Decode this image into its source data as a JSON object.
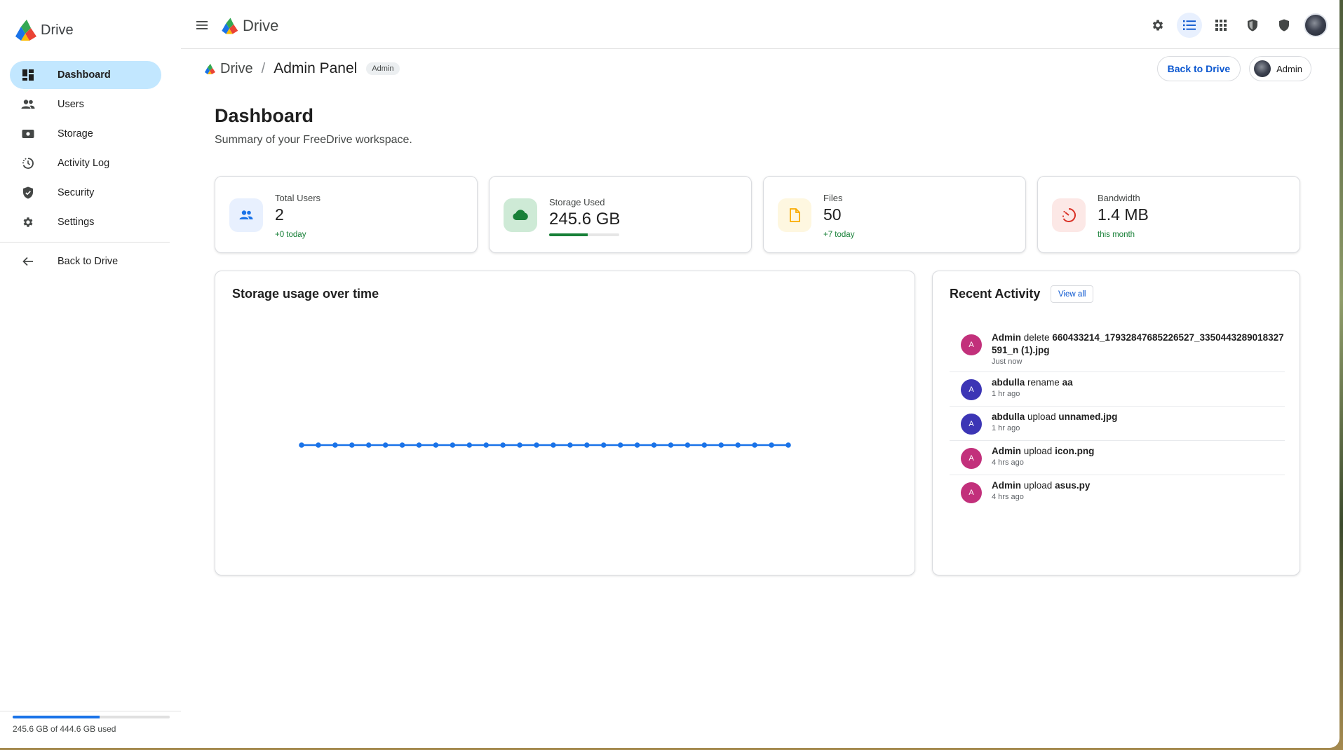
{
  "app": {
    "name": "Drive"
  },
  "sidebar": {
    "items": [
      {
        "label": "Dashboard",
        "icon": "dashboard-icon",
        "active": true
      },
      {
        "label": "Users",
        "icon": "users-icon",
        "active": false
      },
      {
        "label": "Storage",
        "icon": "storage-icon",
        "active": false
      },
      {
        "label": "Activity Log",
        "icon": "history-icon",
        "active": false
      },
      {
        "label": "Security",
        "icon": "shield-icon",
        "active": false
      },
      {
        "label": "Settings",
        "icon": "gear-icon",
        "active": false
      }
    ],
    "back_label": "Back to Drive",
    "quota": {
      "text": "245.6 GB of 444.6 GB used",
      "fraction": 0.552
    }
  },
  "topbar": {
    "title": "Drive",
    "icons": [
      "settings-icon",
      "list-view-icon",
      "apps-grid-icon",
      "admin-shield-icon",
      "security-shield-icon",
      "account-avatar"
    ]
  },
  "breadcrumb": {
    "root": "Drive",
    "separator": "/",
    "current": "Admin Panel",
    "badge": "Admin"
  },
  "actions": {
    "back_label": "Back to Drive",
    "user_label": "Admin"
  },
  "page": {
    "title": "Dashboard",
    "subtitle": "Summary of your FreeDrive workspace."
  },
  "stats": [
    {
      "label": "Total Users",
      "value": "2",
      "sub": "+0 today",
      "icon": "people-icon",
      "color": "#1a73e8",
      "bg": "#e8f0fe"
    },
    {
      "label": "Storage Used",
      "value": "245.6 GB",
      "fraction": 0.55,
      "icon": "cloud-icon",
      "color": "#188038",
      "bg": "#ceead6"
    },
    {
      "label": "Files",
      "value": "50",
      "sub": "+7 today",
      "icon": "file-icon",
      "color": "#f9ab00",
      "bg": "#fef7e0"
    },
    {
      "label": "Bandwidth",
      "value": "1.4 MB",
      "sub": "this month",
      "icon": "gauge-icon",
      "color": "#d93025",
      "bg": "#fce8e6"
    }
  ],
  "chart": {
    "title": "Storage usage over time",
    "color": "#1a73e8"
  },
  "chart_data": {
    "type": "line",
    "title": "Storage usage over time",
    "x": [
      1,
      2,
      3,
      4,
      5,
      6,
      7,
      8,
      9,
      10,
      11,
      12,
      13,
      14,
      15,
      16,
      17,
      18,
      19,
      20,
      21,
      22,
      23,
      24,
      25,
      26,
      27,
      28,
      29,
      30
    ],
    "series": [
      {
        "values": [
          245.6,
          245.6,
          245.6,
          245.6,
          245.6,
          245.6,
          245.6,
          245.6,
          245.6,
          245.6,
          245.6,
          245.6,
          245.6,
          245.6,
          245.6,
          245.6,
          245.6,
          245.6,
          245.6,
          245.6,
          245.6,
          245.6,
          245.6,
          245.6,
          245.6,
          245.6,
          245.6,
          245.6,
          245.6,
          245.6
        ]
      }
    ],
    "grid": false,
    "xlabel": "",
    "ylabel": ""
  },
  "activity": {
    "title": "Recent Activity",
    "view_all": "View all",
    "items": [
      {
        "initial": "A",
        "user": "Admin",
        "action": "delete",
        "target": "660433214_17932847685226527_3350443289018327591_n (1).jpg",
        "time": "Just now",
        "color": "#c2307b"
      },
      {
        "initial": "A",
        "user": "abdulla",
        "action": "rename",
        "target": "aa",
        "time": "1 hr ago",
        "color": "#3c35b5"
      },
      {
        "initial": "A",
        "user": "abdulla",
        "action": "upload",
        "target": "unnamed.jpg",
        "time": "1 hr ago",
        "color": "#3c35b5"
      },
      {
        "initial": "A",
        "user": "Admin",
        "action": "upload",
        "target": "icon.png",
        "time": "4 hrs ago",
        "color": "#c2307b"
      },
      {
        "initial": "A",
        "user": "Admin",
        "action": "upload",
        "target": "asus.py",
        "time": "4 hrs ago",
        "color": "#c2307b"
      }
    ]
  }
}
